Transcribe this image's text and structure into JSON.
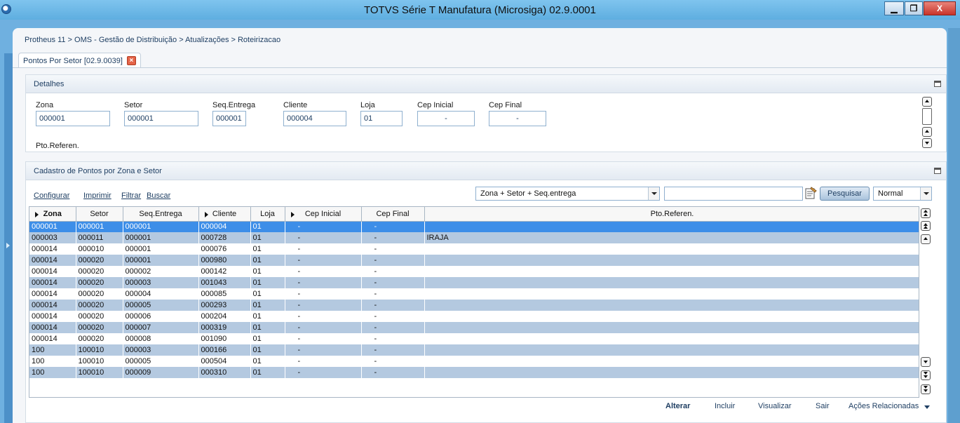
{
  "window": {
    "title": "TOTVS Série T Manufatura (Microsiga) 02.9.0001",
    "min_label": "▁",
    "max_label": "❐",
    "close_label": "X"
  },
  "breadcrumb": "Protheus 11 > OMS - Gestão de Distribuição > Atualizações > Roteirizacao",
  "tab": {
    "label": "Pontos Por Setor [02.9.0039]",
    "close_label": "×"
  },
  "details": {
    "title": "Detalhes",
    "fields": {
      "zona": {
        "label": "Zona",
        "value": "000001"
      },
      "setor": {
        "label": "Setor",
        "value": "000001"
      },
      "seq_entrega": {
        "label": "Seq.Entrega",
        "value": "000001"
      },
      "cliente": {
        "label": "Cliente",
        "value": "000004"
      },
      "loja": {
        "label": "Loja",
        "value": "01"
      },
      "cep_inicial": {
        "label": "Cep Inicial",
        "value": "-"
      },
      "cep_final": {
        "label": "Cep Final",
        "value": "-"
      },
      "pto_referen": {
        "label": "Pto.Referen."
      }
    }
  },
  "grid": {
    "title": "Cadastro de Pontos por Zona e Setor",
    "toolbar": {
      "configurar": "Configurar",
      "imprimir": "Imprimir",
      "filtrar": "Filtrar",
      "buscar": "Buscar",
      "order_select": "Zona + Setor + Seq.entrega",
      "search_placeholder": "",
      "search_button": "Pesquisar",
      "view_select": "Normal"
    },
    "columns": [
      "Zona",
      "Setor",
      "Seq.Entrega",
      "Cliente",
      "Loja",
      "Cep Inicial",
      "Cep Final",
      "Pto.Referen."
    ],
    "rows": [
      [
        "000001",
        "000001",
        "000001",
        "000004",
        "01",
        "-",
        "-",
        ""
      ],
      [
        "000003",
        "000011",
        "000001",
        "000728",
        "01",
        "-",
        "-",
        "IRAJA"
      ],
      [
        "000014",
        "000010",
        "000001",
        "000076",
        "01",
        "-",
        "-",
        ""
      ],
      [
        "000014",
        "000020",
        "000001",
        "000980",
        "01",
        "-",
        "-",
        ""
      ],
      [
        "000014",
        "000020",
        "000002",
        "000142",
        "01",
        "-",
        "-",
        ""
      ],
      [
        "000014",
        "000020",
        "000003",
        "001043",
        "01",
        "-",
        "-",
        ""
      ],
      [
        "000014",
        "000020",
        "000004",
        "000085",
        "01",
        "-",
        "-",
        ""
      ],
      [
        "000014",
        "000020",
        "000005",
        "000293",
        "01",
        "-",
        "-",
        ""
      ],
      [
        "000014",
        "000020",
        "000006",
        "000204",
        "01",
        "-",
        "-",
        ""
      ],
      [
        "000014",
        "000020",
        "000007",
        "000319",
        "01",
        "-",
        "-",
        ""
      ],
      [
        "000014",
        "000020",
        "000008",
        "001090",
        "01",
        "-",
        "-",
        ""
      ],
      [
        "100",
        "100010",
        "000003",
        "000166",
        "01",
        "-",
        "-",
        ""
      ],
      [
        "100",
        "100010",
        "000005",
        "000504",
        "01",
        "-",
        "-",
        ""
      ],
      [
        "100",
        "100010",
        "000009",
        "000310",
        "01",
        "-",
        "-",
        ""
      ]
    ],
    "selected_row": 0
  },
  "footer": {
    "alterar": "Alterar",
    "incluir": "Incluir",
    "visualizar": "Visualizar",
    "sair": "Sair",
    "acoes": "Ações Relacionadas"
  },
  "colors": {
    "selected_row": "#3d8ee8",
    "alt_row": "#b4c9e0",
    "titlebar": "#6fb7e6",
    "close_button": "#c7342a"
  }
}
